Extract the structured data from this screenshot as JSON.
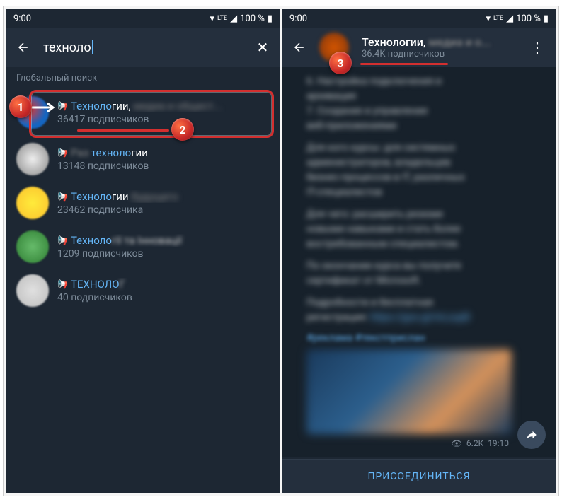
{
  "status": {
    "time": "9:00",
    "lte": "LTE",
    "battery": "100 %"
  },
  "left": {
    "search_value": "техноло",
    "section_label": "Глобальный поиск",
    "results": [
      {
        "title_hl": "Техноло",
        "title_rest": "гии,",
        "sub": "36417 подписчиков"
      },
      {
        "title_hl": "техноло",
        "title_rest": "гии",
        "sub": "13148 подписчиков"
      },
      {
        "title_hl": "Техноло",
        "title_rest": "гии",
        "sub": "23462 подписчика"
      },
      {
        "title_hl": "Техноло",
        "title_rest": "гії та Інновації",
        "sub": "1209 подписчиков"
      },
      {
        "title_hl": "ТЕХНОЛО",
        "title_rest": "Г",
        "sub": "40 подписчиков"
      }
    ]
  },
  "right": {
    "title": "Технологии,",
    "title_blur": "медиа и о...",
    "subtitle": "36.4K подписчиков",
    "views": "6.2K",
    "msg_time": "19:10",
    "join": "ПРИСОЕДИНИТЬСЯ"
  },
  "markers": {
    "m1": "1",
    "m2": "2",
    "m3": "3"
  }
}
